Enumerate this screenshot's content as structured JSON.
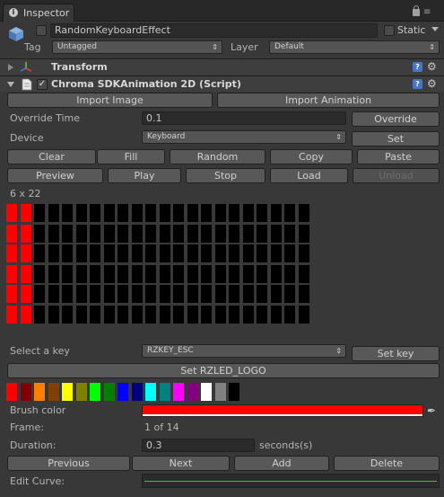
{
  "tab": {
    "label": "Inspector"
  },
  "header": {
    "object_name": "RandomKeyboardEffect",
    "static_label": "Static",
    "tag_label": "Tag",
    "tag_value": "Untagged",
    "layer_label": "Layer",
    "layer_value": "Default"
  },
  "components": {
    "transform": {
      "title": "Transform"
    },
    "script": {
      "title": "Chroma SDKAnimation 2D (Script)"
    }
  },
  "buttons": {
    "import_image": "Import Image",
    "import_animation": "Import Animation",
    "override": "Override",
    "set": "Set",
    "clear": "Clear",
    "fill": "Fill",
    "random": "Random",
    "copy": "Copy",
    "paste": "Paste",
    "preview": "Preview",
    "play": "Play",
    "stop": "Stop",
    "load": "Load",
    "unload": "Unload",
    "set_key": "Set key",
    "set_logo": "Set RZLED_LOGO",
    "previous": "Previous",
    "next": "Next",
    "add": "Add",
    "delete": "Delete"
  },
  "fields": {
    "override_time_label": "Override Time",
    "override_time_value": "0.1",
    "device_label": "Device",
    "device_value": "Keyboard",
    "grid_size": "6 x 22",
    "select_key_label": "Select a key",
    "select_key_value": "RZKEY_ESC",
    "brush_color_label": "Brush color",
    "frame_label": "Frame:",
    "frame_value": "1 of 14",
    "duration_label": "Duration:",
    "duration_value": "0.3",
    "duration_unit": "seconds(s)",
    "edit_curve_label": "Edit Curve:"
  },
  "led_grid": {
    "rows": 6,
    "cols": 22,
    "lit_color": "#ff0000",
    "off_color": "#000000",
    "lit_columns": [
      0,
      1
    ]
  },
  "palette": [
    "#ff0000",
    "#800000",
    "#ff8000",
    "#804000",
    "#ffff00",
    "#808000",
    "#00ff00",
    "#008000",
    "#0000ff",
    "#000080",
    "#00ffff",
    "#008080",
    "#ff00ff",
    "#800080",
    "#ffffff",
    "#808080",
    "#000000"
  ],
  "brush_color": "#ff0000",
  "curve_color": "#3ac23a"
}
